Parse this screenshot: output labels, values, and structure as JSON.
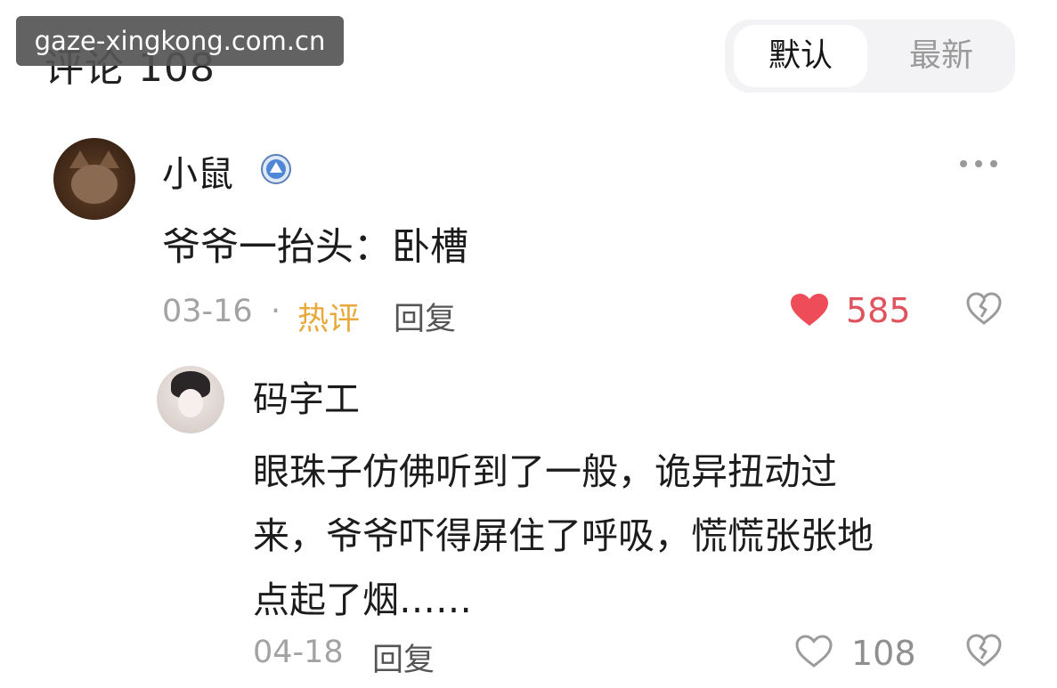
{
  "header": {
    "comment_count_label": "评论 108",
    "sort_options": [
      "默认",
      "最新"
    ],
    "selected_sort": "默认"
  },
  "watermark": "gaze-xingkong.com.cn",
  "comment": {
    "username": "小鼠",
    "text": "爷爷一抬头：卧槽",
    "date": "03-16",
    "separator": "·",
    "tag": "热评",
    "reply_label": "回复",
    "like_count": "585",
    "liked": true,
    "colors": {
      "liked_heart": "#ee4c58",
      "hot_tag": "#e8a93a"
    }
  },
  "reply": {
    "username": "码字工",
    "text_lines": [
      "眼珠子仿佛听到了一般，诡异扭动过",
      "来，爷爷吓得屏住了呼吸，慌慌张张地",
      "点起了烟……"
    ],
    "date": "04-18",
    "reply_label": "回复",
    "like_count": "108",
    "liked": false
  },
  "icons": {
    "badge": "verified-badge-icon",
    "more": "more-options-icon",
    "like": "heart-icon",
    "dislike": "broken-heart-icon"
  }
}
